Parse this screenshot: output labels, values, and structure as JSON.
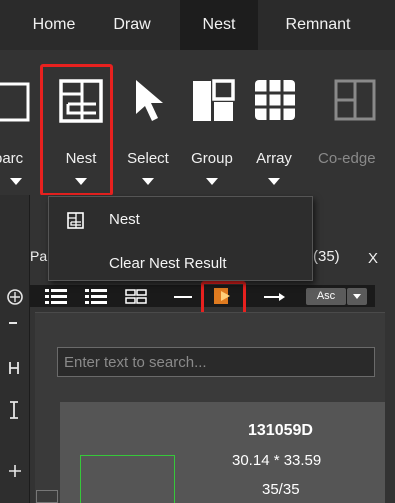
{
  "menubar": {
    "tabs": [
      {
        "label": "Home"
      },
      {
        "label": "Draw"
      },
      {
        "label": "Nest",
        "active": true
      },
      {
        "label": "Remnant"
      }
    ]
  },
  "ribbon": {
    "partial_left_label": "oarc",
    "tools": [
      {
        "label": "Nest",
        "icon": "nest-icon",
        "dropdown": true,
        "highlighted": true
      },
      {
        "label": "Select",
        "icon": "cursor-arrow-icon",
        "dropdown": true
      },
      {
        "label": "Group",
        "icon": "group-blocks-icon",
        "dropdown": true
      },
      {
        "label": "Array",
        "icon": "array-grid-icon",
        "dropdown": true
      },
      {
        "label": "Co-edge",
        "icon": "co-edge-icon",
        "disabled": true
      }
    ]
  },
  "dropdown_menu": {
    "items": [
      {
        "label": "Nest",
        "icon": "nest-icon"
      },
      {
        "label": "Clear Nest Result"
      }
    ]
  },
  "parts_panel": {
    "title_partial": "Pa",
    "count": "(35)",
    "close": "X",
    "toolbar": {
      "icons": [
        "list-large-icon",
        "list-small-icon",
        "grid-view-icon",
        "dash-icon",
        "play-nest-icon",
        "arrow-right-icon"
      ],
      "sort_label": "Asc"
    },
    "search": {
      "placeholder": "Enter text to search..."
    },
    "item": {
      "name": "131059D",
      "size": "30.14 * 33.59",
      "count": "35/35"
    }
  },
  "colors": {
    "highlight": "#e8211f",
    "thumbnail_outline": "#36c83a",
    "play_icon_orange": "#e07b20"
  }
}
